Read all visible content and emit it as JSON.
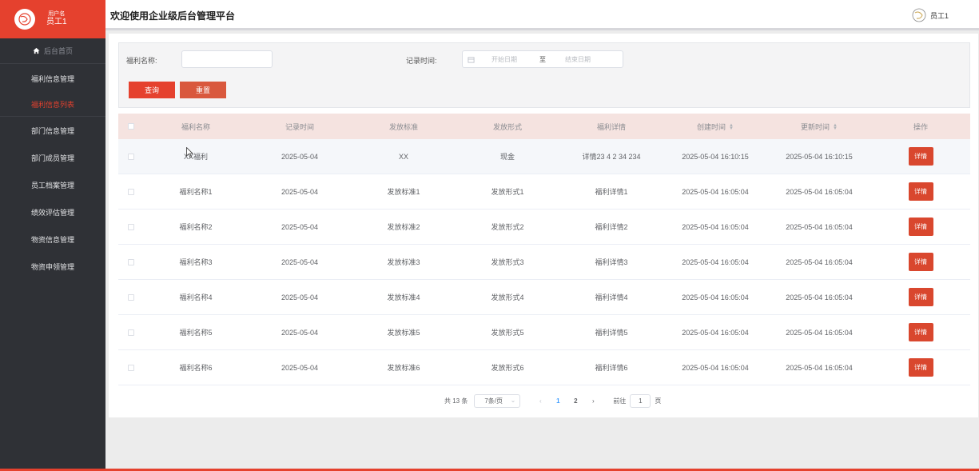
{
  "user": {
    "label": "用户名",
    "name": "员工1"
  },
  "sidebar": {
    "home": "后台首页",
    "items": [
      {
        "label": "福利信息管理"
      },
      {
        "label": "福利信息列表",
        "active": true
      },
      {
        "label": "部门信息管理"
      },
      {
        "label": "部门成员管理"
      },
      {
        "label": "员工档案管理"
      },
      {
        "label": "绩效评估管理"
      },
      {
        "label": "物资信息管理"
      },
      {
        "label": "物资申领管理"
      }
    ]
  },
  "header": {
    "title": "欢迎使用企业级后台管理平台",
    "user_name": "员工1"
  },
  "search": {
    "name_label": "福利名称:",
    "name_value": "",
    "time_label": "记录时间:",
    "start_placeholder": "开始日期",
    "range_sep": "至",
    "end_placeholder": "结束日期",
    "query_button": "查询",
    "reset_button": "重置"
  },
  "table": {
    "columns": [
      "福利名称",
      "记录时间",
      "发放标准",
      "发放形式",
      "福利详情",
      "创建时间",
      "更新时间",
      "操作"
    ],
    "detail_label": "详情",
    "rows": [
      [
        "XX福利",
        "2025-05-04",
        "XX",
        "现金",
        "详情23 4 2 34 234",
        "2025-05-04 16:10:15",
        "2025-05-04 16:10:15"
      ],
      [
        "福利名称1",
        "2025-05-04",
        "发放标准1",
        "发放形式1",
        "福利详情1",
        "2025-05-04 16:05:04",
        "2025-05-04 16:05:04"
      ],
      [
        "福利名称2",
        "2025-05-04",
        "发放标准2",
        "发放形式2",
        "福利详情2",
        "2025-05-04 16:05:04",
        "2025-05-04 16:05:04"
      ],
      [
        "福利名称3",
        "2025-05-04",
        "发放标准3",
        "发放形式3",
        "福利详情3",
        "2025-05-04 16:05:04",
        "2025-05-04 16:05:04"
      ],
      [
        "福利名称4",
        "2025-05-04",
        "发放标准4",
        "发放形式4",
        "福利详情4",
        "2025-05-04 16:05:04",
        "2025-05-04 16:05:04"
      ],
      [
        "福利名称5",
        "2025-05-04",
        "发放标准5",
        "发放形式5",
        "福利详情5",
        "2025-05-04 16:05:04",
        "2025-05-04 16:05:04"
      ],
      [
        "福利名称6",
        "2025-05-04",
        "发放标准6",
        "发放形式6",
        "福利详情6",
        "2025-05-04 16:05:04",
        "2025-05-04 16:05:04"
      ]
    ]
  },
  "pagination": {
    "total": "共 13 条",
    "page_size": "7条/页",
    "pages": [
      "1",
      "2"
    ],
    "current": "1",
    "goto_label": "前往",
    "goto_value": "1",
    "page_suffix": "页"
  },
  "colors": {
    "accent": "#e5412e",
    "sidebar_bg": "#2f3136",
    "header_row_bg": "#f5e3e0",
    "active_page": "#409eff"
  }
}
